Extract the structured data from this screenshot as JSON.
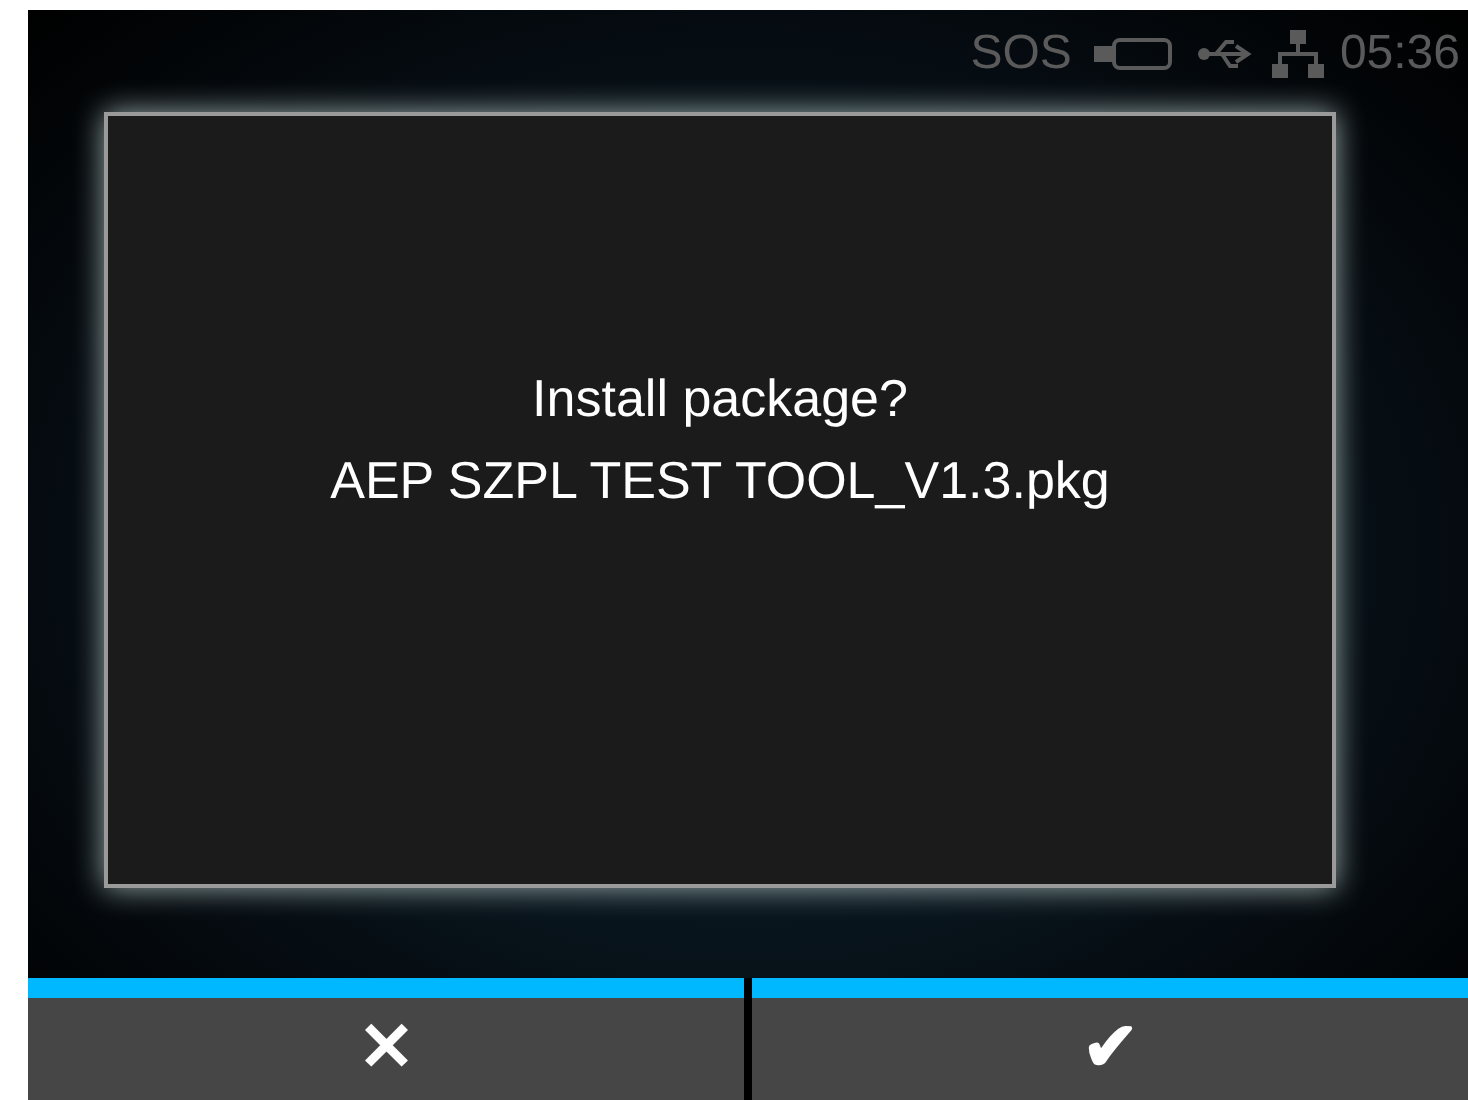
{
  "status_bar": {
    "sos": "SOS",
    "time": "05:36"
  },
  "dialog": {
    "lines": [
      "Install package?",
      "AEP SZPL TEST TOOL_V1.3.pkg"
    ]
  },
  "cancel_button": {
    "label": "✕"
  },
  "confirm_button": {
    "label": "✔"
  }
}
